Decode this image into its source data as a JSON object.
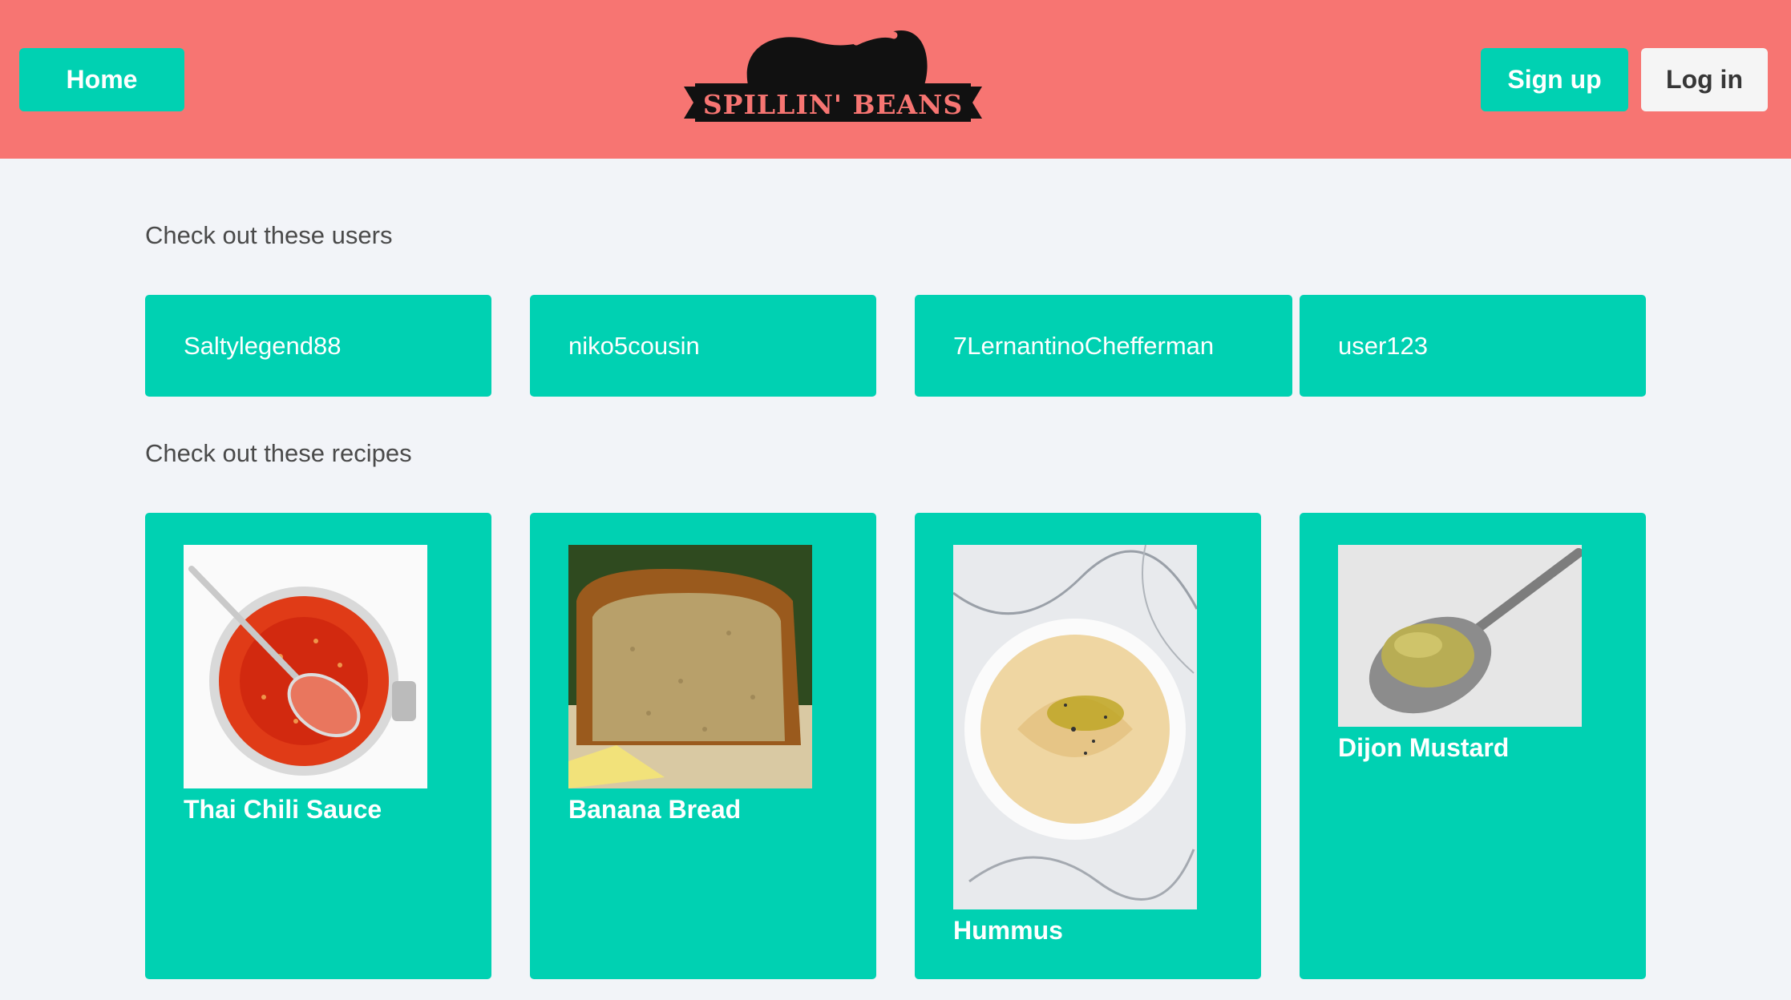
{
  "nav": {
    "home_label": "Home",
    "signup_label": "Sign up",
    "login_label": "Log in",
    "logo_text": "SPILLIN' BEANS"
  },
  "colors": {
    "navbar": "#f77572",
    "accent": "#00d1b2",
    "page_bg": "#f2f4f8",
    "light_button": "#f5f5f5"
  },
  "users_section": {
    "title": "Check out these users",
    "users": [
      "Saltylegend88",
      "niko5cousin",
      "7LernantinoChefferman",
      "user123"
    ]
  },
  "recipes_section": {
    "title": "Check out these recipes",
    "recipes": [
      {
        "name": "Thai Chili Sauce",
        "image": "thai-chili-sauce-photo"
      },
      {
        "name": "Banana Bread",
        "image": "banana-bread-photo"
      },
      {
        "name": "Hummus",
        "image": "hummus-photo"
      },
      {
        "name": "Dijon Mustard",
        "image": "dijon-mustard-photo"
      }
    ]
  }
}
